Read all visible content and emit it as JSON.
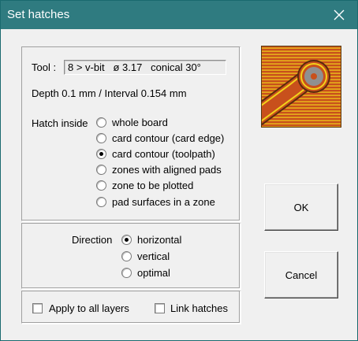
{
  "window": {
    "title": "Set hatches"
  },
  "tool": {
    "label": "Tool :",
    "value": "8 > v-bit   ø 3.17   conical 30°"
  },
  "depth_line": "Depth 0.1 mm  /  Interval 0.154 mm",
  "hatch": {
    "label": "Hatch inside",
    "options": [
      {
        "label": "whole board",
        "checked": false
      },
      {
        "label": "card contour (card edge)",
        "checked": false
      },
      {
        "label": "card contour (toolpath)",
        "checked": true
      },
      {
        "label": "zones with aligned pads",
        "checked": false
      },
      {
        "label": "zone to be plotted",
        "checked": false
      },
      {
        "label": "pad surfaces in a zone",
        "checked": false
      }
    ]
  },
  "direction": {
    "label": "Direction",
    "options": [
      {
        "label": "horizontal",
        "checked": true
      },
      {
        "label": "vertical",
        "checked": false
      },
      {
        "label": "optimal",
        "checked": false
      }
    ]
  },
  "checkboxes": {
    "apply_all": {
      "label": "Apply to all layers",
      "checked": false
    },
    "link": {
      "label": "Link hatches",
      "checked": false
    }
  },
  "buttons": {
    "ok": "OK",
    "cancel": "Cancel"
  },
  "colors": {
    "titlebar": "#2f7b80",
    "copper": "#c8501c",
    "hatch_lines": "#f2d21a",
    "pad": "#909090"
  }
}
